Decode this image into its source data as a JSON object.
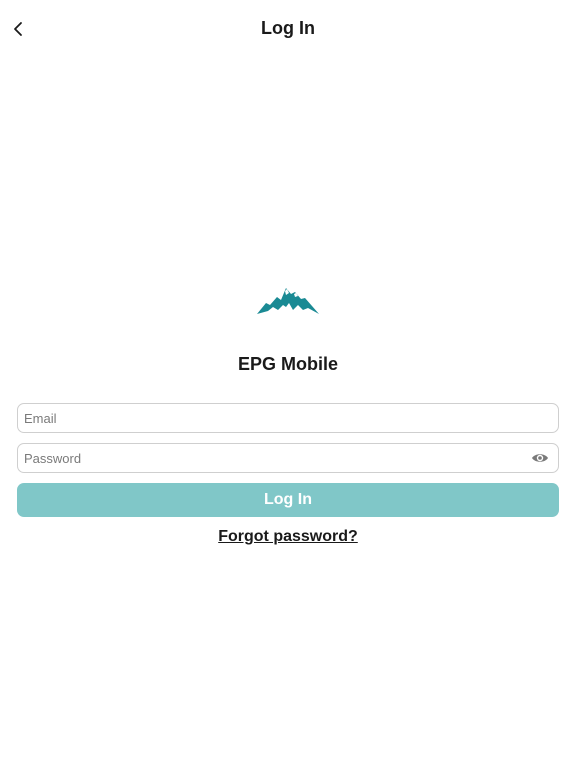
{
  "nav": {
    "title": "Log In",
    "back_icon": "chevron-left-icon"
  },
  "brand": {
    "logo_icon": "mountain-logo-icon",
    "logo_color": "#1a8a94",
    "app_name": "EPG Mobile"
  },
  "form": {
    "email": {
      "placeholder": "Email",
      "value": ""
    },
    "password": {
      "placeholder": "Password",
      "value": "",
      "toggle_icon": "eye-icon"
    },
    "login_label": "Log In",
    "login_color": "#80c7c8",
    "forgot_label": "Forgot password?"
  }
}
